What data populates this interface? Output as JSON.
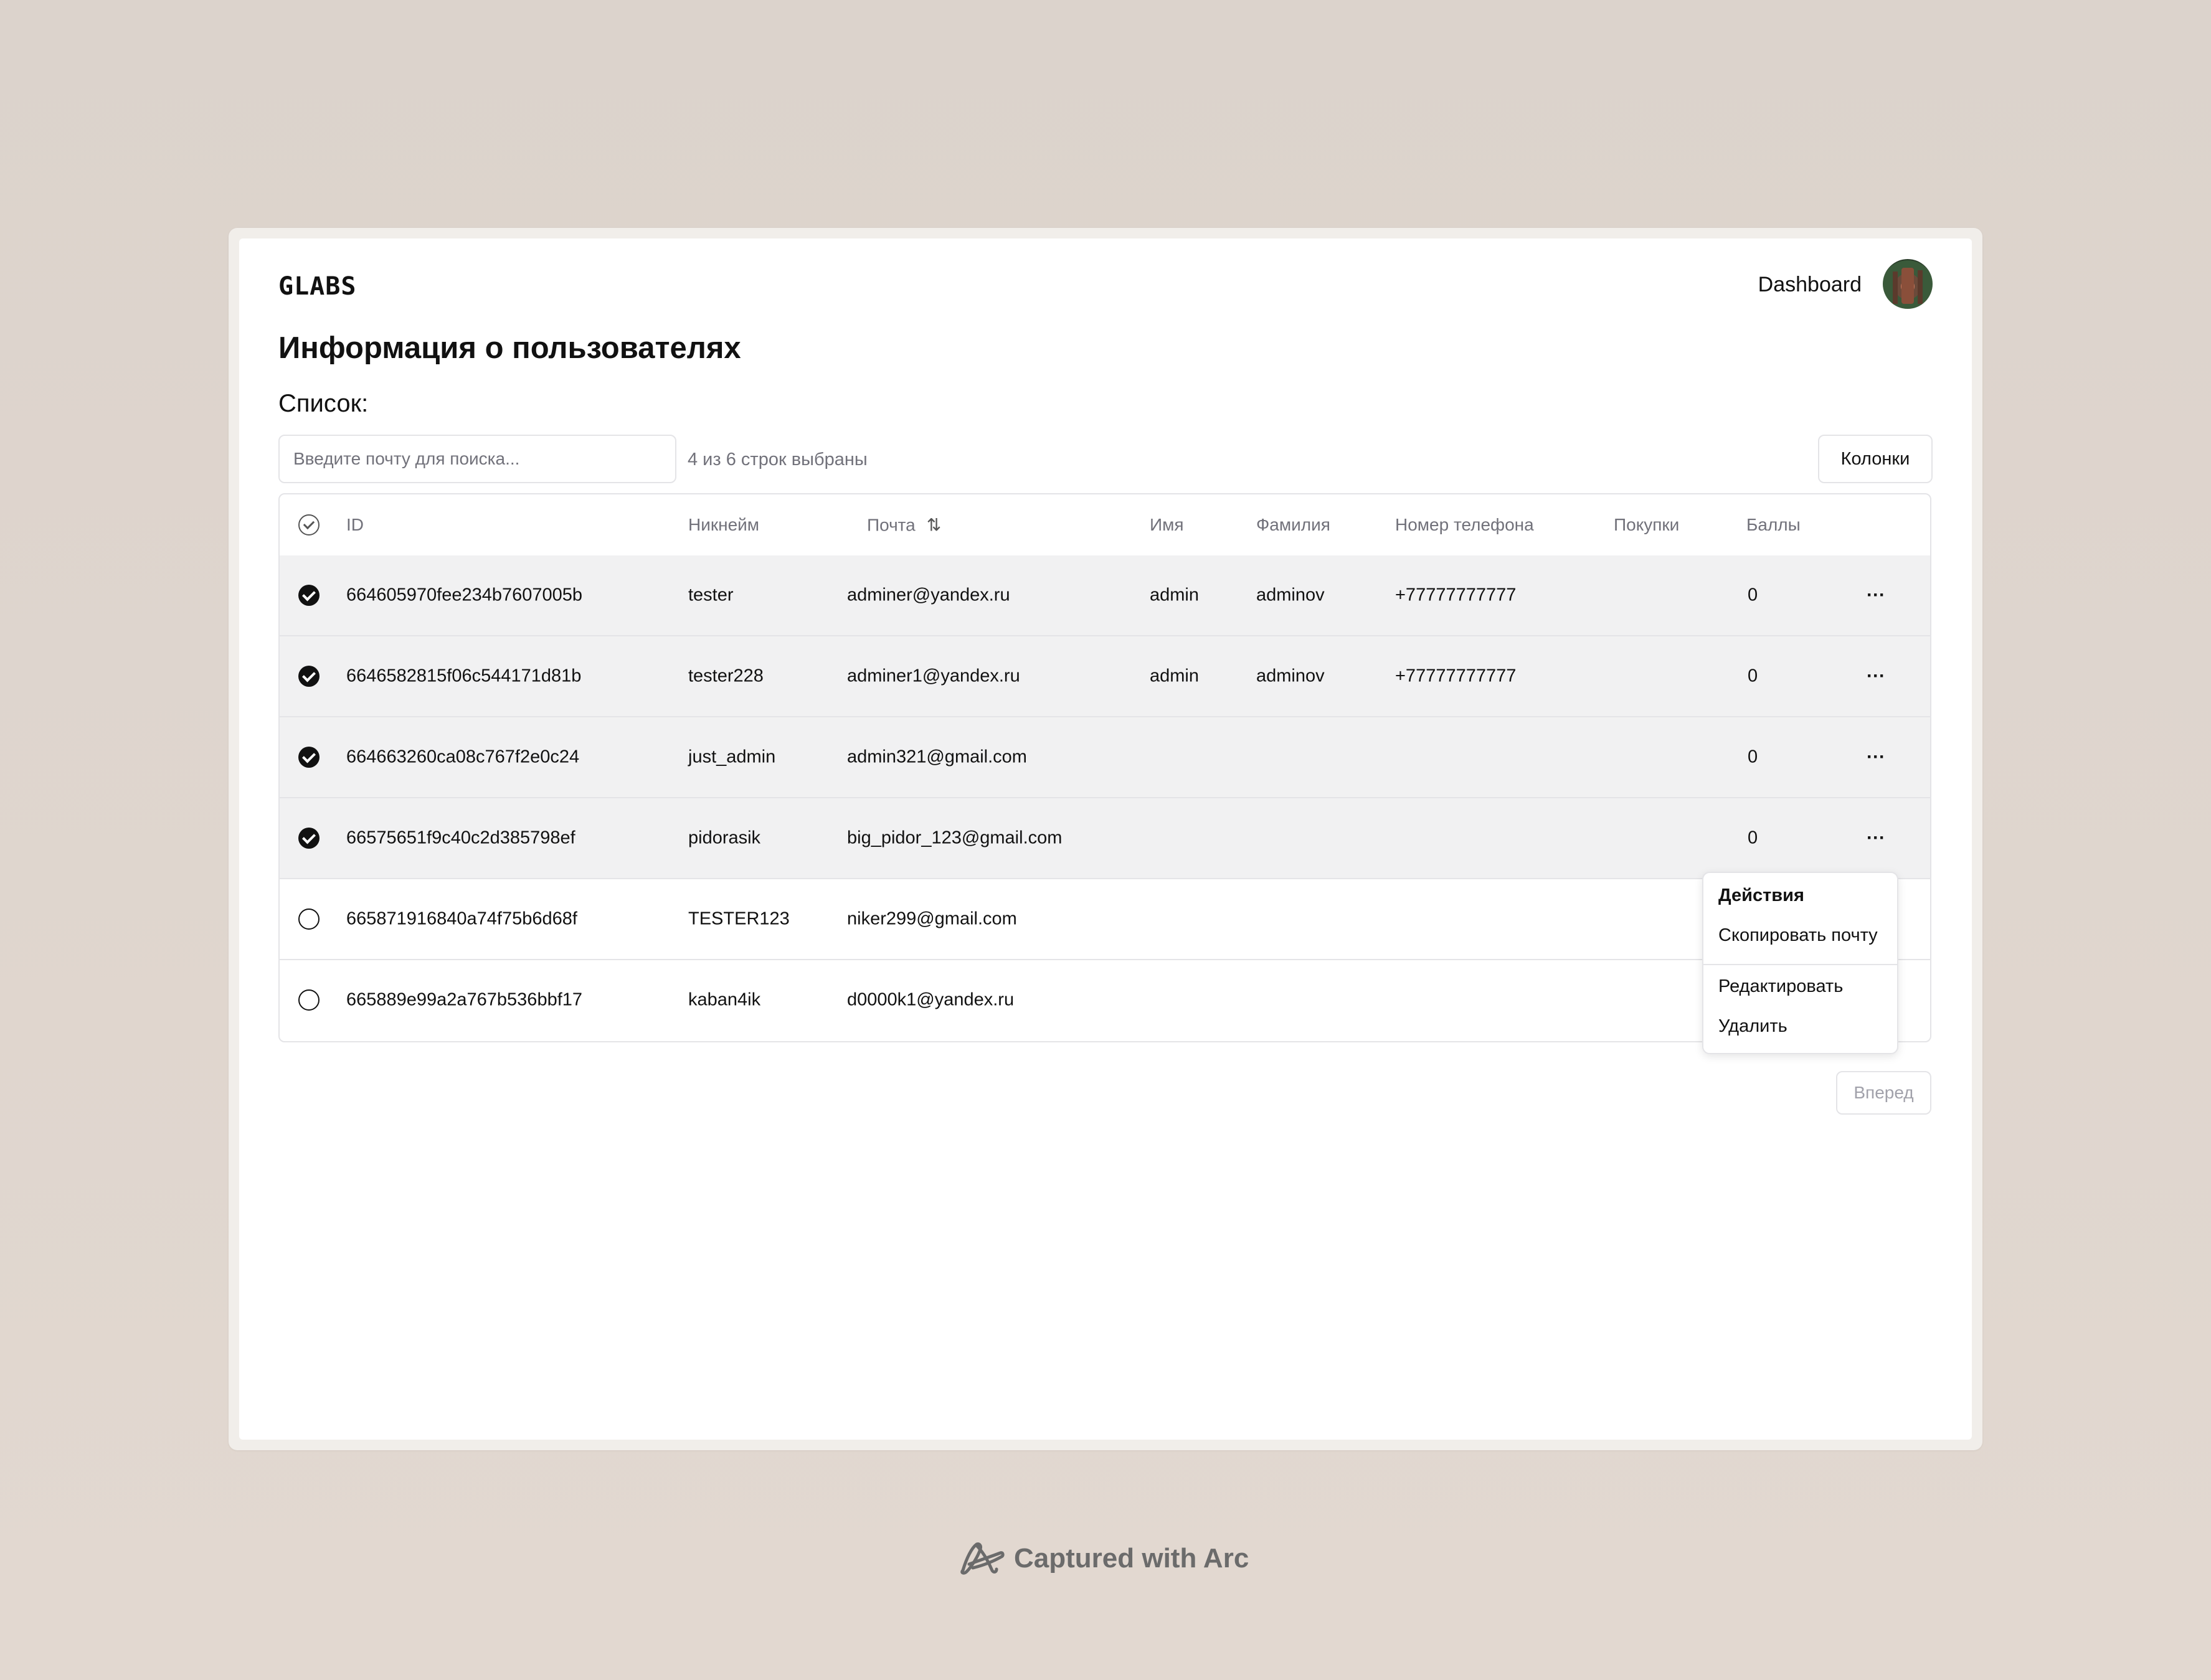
{
  "header": {
    "brand": "GLABS",
    "dashboard_link": "Dashboard",
    "avatar": "avatar-photo"
  },
  "page": {
    "title": "Информация о пользователях",
    "list_label": "Список:"
  },
  "toolbar": {
    "search_placeholder": "Введите почту для поиска...",
    "selection_status": "4 из 6 строк выбраны",
    "columns_button": "Колонки"
  },
  "table": {
    "columns": {
      "id": "ID",
      "nickname": "Никнейм",
      "email": "Почта",
      "first_name": "Имя",
      "last_name": "Фамилия",
      "phone": "Номер телефона",
      "purchases": "Покупки",
      "points": "Баллы"
    },
    "rows": [
      {
        "selected": true,
        "id": "664605970fee234b7607005b",
        "nickname": "tester",
        "email": "adminer@yandex.ru",
        "first_name": "admin",
        "last_name": "adminov",
        "phone": "+77777777777",
        "purchases": "",
        "points": "0"
      },
      {
        "selected": true,
        "id": "6646582815f06c544171d81b",
        "nickname": "tester228",
        "email": "adminer1@yandex.ru",
        "first_name": "admin",
        "last_name": "adminov",
        "phone": "+77777777777",
        "purchases": "",
        "points": "0"
      },
      {
        "selected": true,
        "id": "664663260ca08c767f2e0c24",
        "nickname": "just_admin",
        "email": "admin321@gmail.com",
        "first_name": "",
        "last_name": "",
        "phone": "",
        "purchases": "",
        "points": "0"
      },
      {
        "selected": true,
        "id": "66575651f9c40c2d385798ef",
        "nickname": "pidorasik",
        "email": "big_pidor_123@gmail.com",
        "first_name": "",
        "last_name": "",
        "phone": "",
        "purchases": "",
        "points": "0"
      },
      {
        "selected": false,
        "id": "665871916840a74f75b6d68f",
        "nickname": "TESTER123",
        "email": "niker299@gmail.com",
        "first_name": "",
        "last_name": "",
        "phone": "",
        "purchases": "",
        "points": ""
      },
      {
        "selected": false,
        "id": "665889e99a2a767b536bbf17",
        "nickname": "kaban4ik",
        "email": "d0000k1@yandex.ru",
        "first_name": "",
        "last_name": "",
        "phone": "",
        "purchases": "",
        "points": ""
      }
    ],
    "row_actions_glyph": "···"
  },
  "actions_menu": {
    "heading": "Действия",
    "copy_email": "Скопировать почту",
    "edit": "Редактировать",
    "delete": "Удалить"
  },
  "pagination": {
    "next": "Вперед"
  },
  "footer": {
    "text": "Captured with Arc",
    "logo": "arc-logo-icon"
  },
  "colors": {
    "page_bg": "#dcd3cc",
    "selected_row_bg": "#f1f1f2",
    "border": "#e4e4e7",
    "muted_text": "#71717a"
  }
}
